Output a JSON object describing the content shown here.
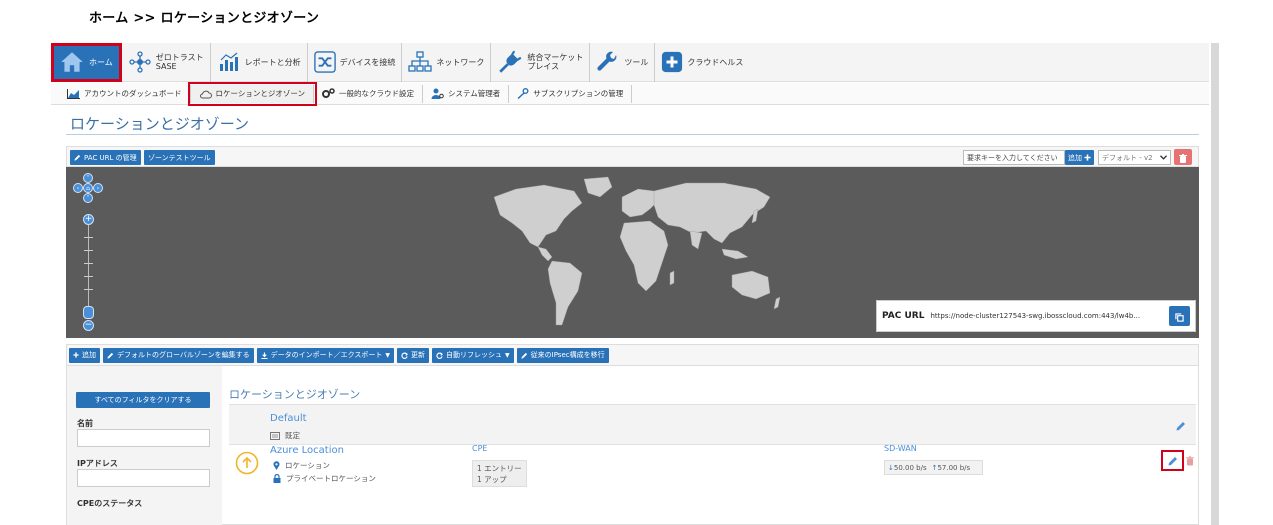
{
  "breadcrumb": "ホーム >> ロケーションとジオゾーン",
  "topnav": {
    "items": [
      {
        "label": "ホーム",
        "icon": "home-icon"
      },
      {
        "label_line1": "ゼロトラスト",
        "label_line2": "SASE",
        "icon": "network-node-icon"
      },
      {
        "label": "レポートと分析",
        "icon": "chart-icon"
      },
      {
        "label": "デバイスを接続",
        "icon": "shuffle-icon"
      },
      {
        "label": "ネットワーク",
        "icon": "sitemap-icon"
      },
      {
        "label_line1": "統合マーケット",
        "label_line2": "プレイス",
        "icon": "plug-icon"
      },
      {
        "label": "ツール",
        "icon": "wrench-icon"
      },
      {
        "label": "クラウドヘルス",
        "icon": "plus-square-icon"
      }
    ]
  },
  "subnav": {
    "items": [
      {
        "label": "アカウントのダッシュボード",
        "icon": "area-chart-icon"
      },
      {
        "label": "ロケーションとジオゾーン",
        "icon": "cloud-icon"
      },
      {
        "label": "一般的なクラウド設定",
        "icon": "gears-icon"
      },
      {
        "label": "システム管理者",
        "icon": "user-cog-icon"
      },
      {
        "label": "サブスクリプションの管理",
        "icon": "key-icon"
      }
    ]
  },
  "page_title": "ロケーションとジオゾーン",
  "map_toolbar": {
    "pac_manage": "PAC URL の管理",
    "zone_test": "ゾーンテストツール",
    "key_placeholder": "要求キーを入力してください",
    "add_label": "追加",
    "default_select": "デフォルト - v2"
  },
  "pac": {
    "label": "PAC URL",
    "url": "https://node-cluster127543-swg.ibosscloud.com:443/lw4b..."
  },
  "actions": {
    "add": "追加",
    "edit_global": "デフォルトのグローバルゾーンを編集する",
    "import_export": "データのインポート／エクスポート",
    "refresh": "更新",
    "auto_refresh": "自動リフレッシュ",
    "migrate_ipsec": "従来のIPsec構成を移行"
  },
  "filters": {
    "clear": "すべてのフィルタをクリアする",
    "name_label": "名前",
    "ip_label": "IPアドレス",
    "cpe_status_label": "CPEのステータス"
  },
  "list": {
    "heading": "ロケーションとジオゾーン",
    "rows": [
      {
        "name": "Default",
        "sub": "既定"
      },
      {
        "name": "Azure Location",
        "sub1": "ロケーション",
        "sub2": "プライベートロケーション",
        "cpe_head": "CPE",
        "cpe_line1": "1 エントリー",
        "cpe_line2": "1 アップ",
        "sdwan_head": "SD-WAN",
        "sdwan_down": "50.00 b/s",
        "sdwan_up": "57.00 b/s"
      }
    ]
  },
  "colors": {
    "primary": "#2a72b8",
    "highlight": "#d0021b",
    "map_bg": "#5b5b5b",
    "land": "#cfcfcf",
    "status_yellow": "#f0b429"
  }
}
